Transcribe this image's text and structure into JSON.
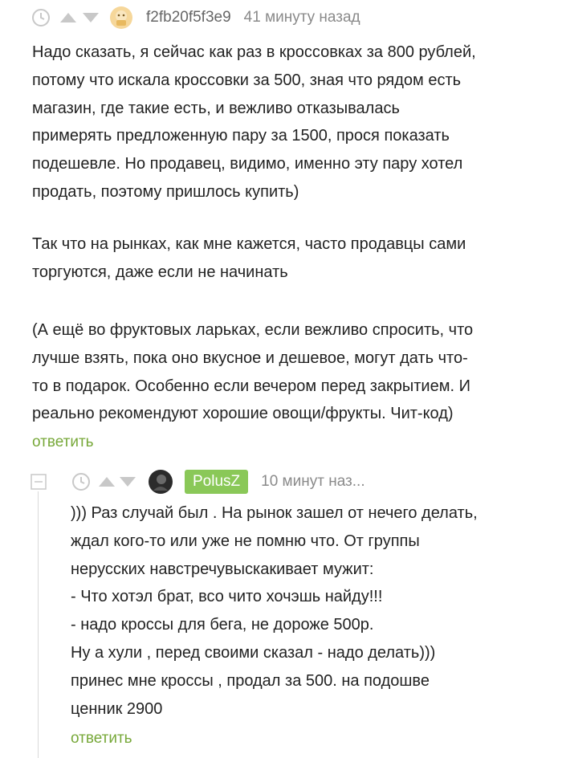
{
  "comment1": {
    "icons": [
      "clock-icon",
      "upvote-icon",
      "downvote-icon",
      "avatar"
    ],
    "username": "f2fb20f5f3e9",
    "time": "41 минуту назад",
    "paragraphs": [
      "Надо сказать, я сейчас как раз в кроссовках за 800 рублей,\nпотому что искала кроссовки за 500, зная что рядом есть\nмагазин, где такие есть, и вежливо отказывалась\nпримерять предложенную пару за 1500, прося показать\nподешевле. Но продавец, видимо, именно эту пару хотел\nпродать, поэтому пришлось купить)",
      "Так что на рынках, как мне кажется, часто продавцы сами\nторгуются, даже если не начинать",
      "(А ещё во фруктовых ларьках, если вежливо спросить, что\nлучше взять, пока оно вкусное и дешевое, могут дать что-\nто в подарок. Особенно если вечером перед закрытием. И\nреально рекомендуют хорошие овощи/фрукты. Чит-код)"
    ],
    "reply_label": "ответить"
  },
  "comment2": {
    "icons": [
      "collapse-icon",
      "clock-icon",
      "upvote-icon",
      "downvote-icon",
      "avatar"
    ],
    "username": "PolusZ",
    "time": "10 минут наз...",
    "text": "))) Раз случай был . На рынок зашел от нечего делать,\nждал кого-то или уже не помню что. От группы\nнерусских навстречувыскакивает мужит:\n- Что хотэл брат, всо чито хочэшь найду!!!\n- надо кроссы для бега, не дороже 500р.\nНу а хули , перед своими сказал - надо делать)))\nпринес мне кроссы , продал за 500. на подошве\nценник 2900",
    "reply_label": "ответить"
  },
  "colors": {
    "accent_green": "#8ac858",
    "reply_green": "#77a839",
    "icon_gray": "#c8c8c8",
    "text": "#222222"
  }
}
